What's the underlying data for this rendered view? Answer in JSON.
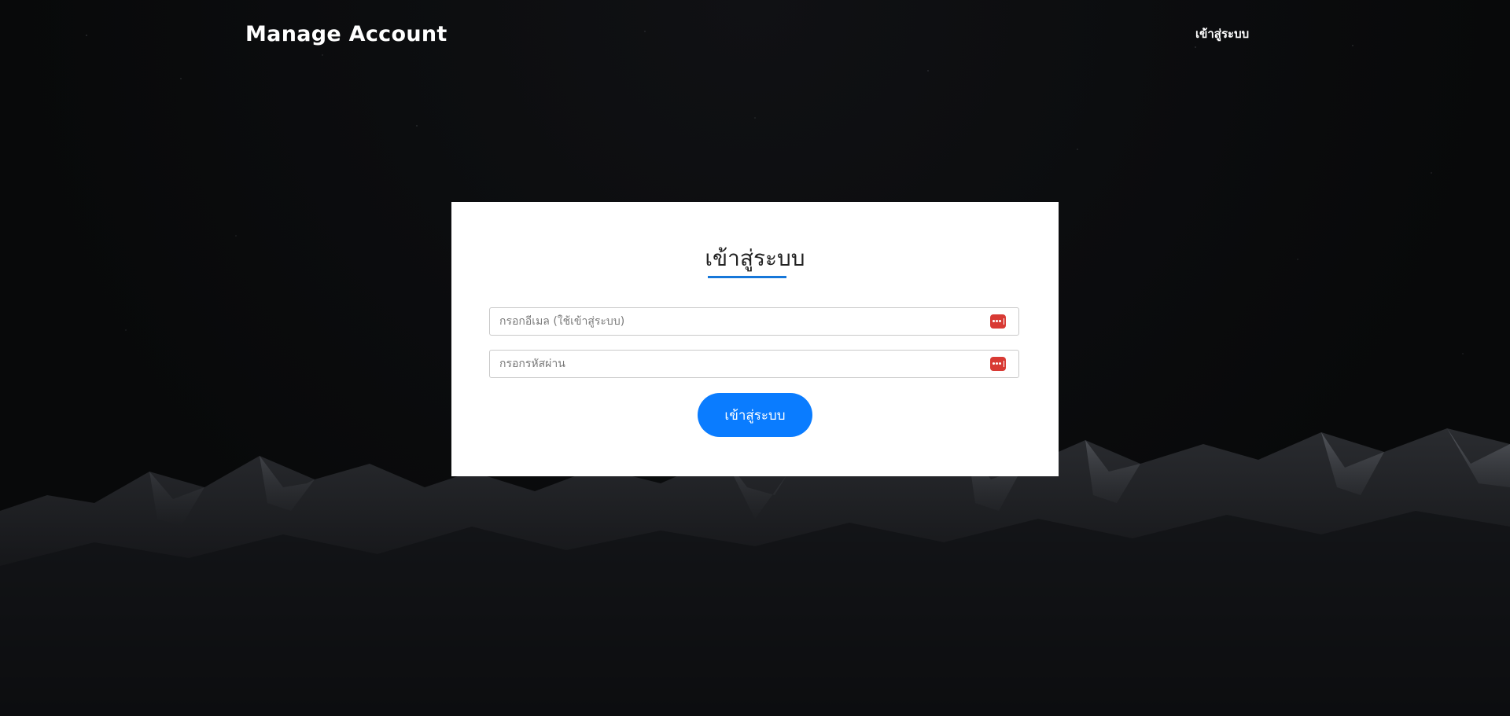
{
  "header": {
    "title": "Manage Account",
    "login_link": "เข้าสู่ระบบ"
  },
  "login_card": {
    "title": "เข้าสู่ระบบ",
    "email_placeholder": "กรอกอีเมล (ใช้เข้าสู่ระบบ)",
    "password_placeholder": "กรอกรหัสผ่าน",
    "submit_label": "เข้าสู่ระบบ"
  },
  "colors": {
    "accent": "#0a7cff",
    "underline": "#1677d9",
    "field_icon": "#d83a34",
    "background": "#08090a"
  },
  "icons": {
    "field_icon": "password-manager-icon"
  }
}
